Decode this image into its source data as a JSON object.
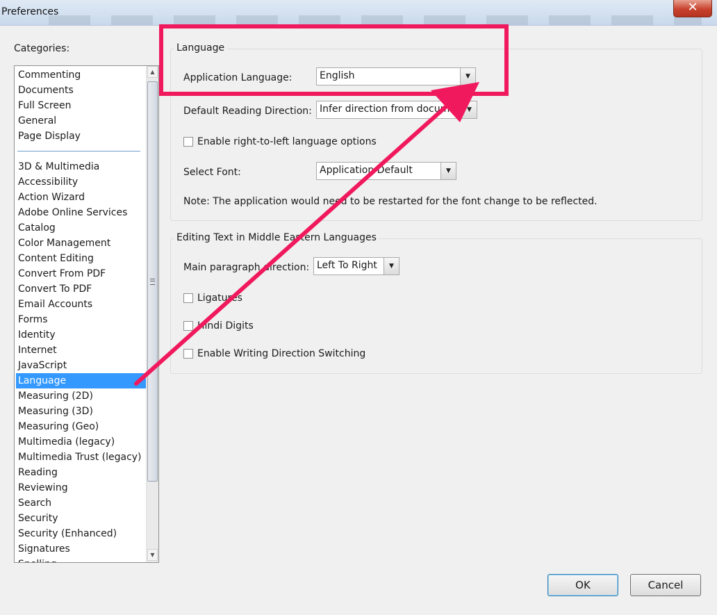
{
  "window": {
    "title": "Preferences",
    "close_glyph": "✕"
  },
  "categories": {
    "label": "Categories:",
    "pinned": [
      "Commenting",
      "Documents",
      "Full Screen",
      "General",
      "Page Display"
    ],
    "items": [
      "3D & Multimedia",
      "Accessibility",
      "Action Wizard",
      "Adobe Online Services",
      "Catalog",
      "Color Management",
      "Content Editing",
      "Convert From PDF",
      "Convert To PDF",
      "Email Accounts",
      "Forms",
      "Identity",
      "Internet",
      "JavaScript",
      "Language",
      "Measuring (2D)",
      "Measuring (3D)",
      "Measuring (Geo)",
      "Multimedia (legacy)",
      "Multimedia Trust (legacy)",
      "Reading",
      "Reviewing",
      "Search",
      "Security",
      "Security (Enhanced)",
      "Signatures",
      "Spelling"
    ],
    "selected": "Language"
  },
  "language_group": {
    "title": "Language",
    "app_language_label": "Application Language:",
    "app_language_value": "English",
    "reading_direction_label": "Default Reading Direction:",
    "reading_direction_value": "Infer direction from document",
    "rtl_label": "Enable right-to-left language options",
    "rtl_checked": false,
    "font_label": "Select Font:",
    "font_value": "Application Default",
    "note": "Note: The application would need to be restarted for the font change to be reflected."
  },
  "middle_east_group": {
    "title": "Editing Text in Middle Eastern Languages",
    "paragraph_dir_label": "Main paragraph direction:",
    "paragraph_dir_value": "Left To Right",
    "ligatures_label": "Ligatures",
    "ligatures_checked": false,
    "hindi_label": "Hindi Digits",
    "hindi_checked": false,
    "switching_label": "Enable Writing Direction Switching",
    "switching_checked": false
  },
  "buttons": {
    "ok": "OK",
    "cancel": "Cancel"
  },
  "annotation": {
    "color": "#f0195d"
  },
  "colors": {
    "selection": "#3399ff",
    "separator": "#6d9ec9"
  }
}
